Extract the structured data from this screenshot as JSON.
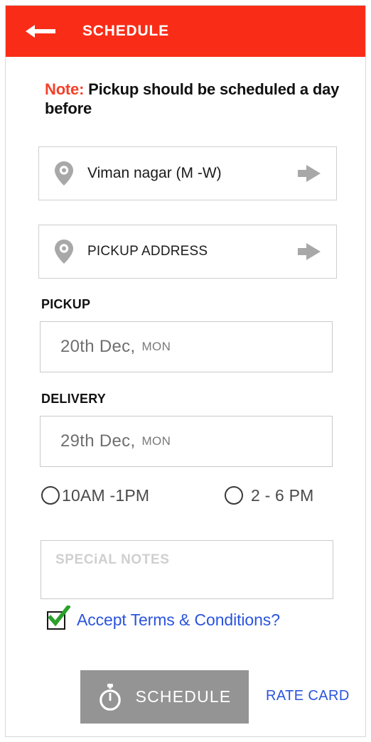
{
  "header": {
    "back_icon": "back-arrow-icon",
    "title": "SCHEDULE",
    "background_color": "#f92d17",
    "title_color": "#ffffff"
  },
  "note": {
    "label": "Note:",
    "label_color": "#f4402a",
    "text": " Pickup should be scheduled a day before",
    "text_color": "#111111"
  },
  "addresses": [
    {
      "icon": "map-pin-icon",
      "value": "Viman nagar (M -W)",
      "action_icon": "arrow-right-icon"
    },
    {
      "icon": "map-pin-icon",
      "value": "PICKUP ADDRESS",
      "action_icon": "arrow-right-icon"
    }
  ],
  "pickup": {
    "label": "PICKUP",
    "date": "20th  Dec,",
    "weekday": "MON"
  },
  "delivery": {
    "label": "DELIVERY",
    "date": "29th  Dec,",
    "weekday": "MON"
  },
  "time_slots": {
    "options": [
      {
        "label": "10AM -1PM",
        "selected": false
      },
      {
        "label": "2 - 6 PM",
        "selected": false
      }
    ]
  },
  "special_notes": {
    "placeholder": "SPECiAL NOTES",
    "value": ""
  },
  "terms": {
    "checked": true,
    "label": "Accept Terms & Conditions?",
    "label_color": "#2b54dd",
    "check_color": "#2aa12a"
  },
  "footer": {
    "schedule_icon": "stopwatch-icon",
    "schedule_label": "SCHEDULE",
    "schedule_bg": "#949494",
    "rate_card_label": "RATE CARD",
    "rate_card_color": "#2b54dd"
  }
}
